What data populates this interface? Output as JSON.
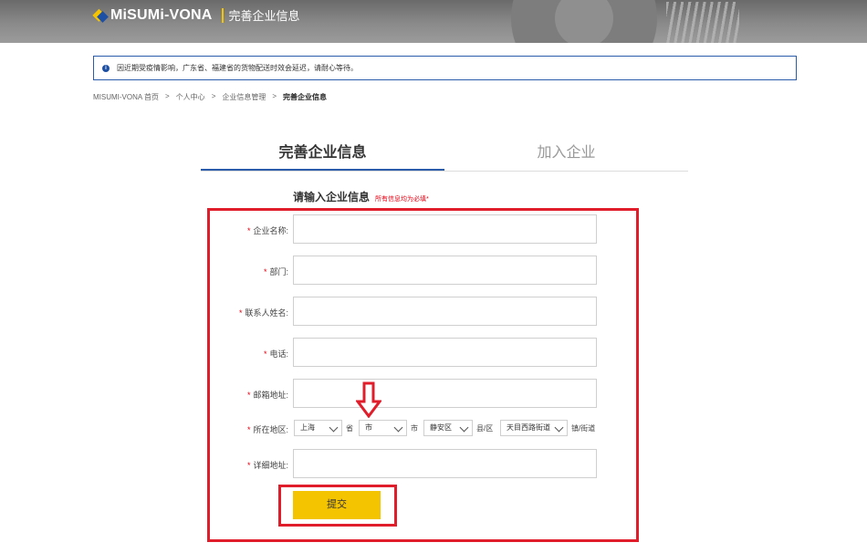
{
  "header": {
    "logo_text": "MiSUMi-VONA",
    "subtitle": "完善企业信息"
  },
  "notice": {
    "icon": "info-icon",
    "text": "因近期受疫情影响，广东省、福建省的货物配送时效会延迟，请耐心等待。"
  },
  "breadcrumb": {
    "items": [
      "MISUMI-VONA 首页",
      "个人中心",
      "企业信息管理",
      "完善企业信息"
    ],
    "separator": ">"
  },
  "tabs": [
    {
      "label": "完善企业信息",
      "active": true
    },
    {
      "label": "加入企业",
      "active": false
    }
  ],
  "form": {
    "heading": "请输入企业信息",
    "required_note": "所有信息均为必填*",
    "required_mark": "*",
    "fields": {
      "company_name": "企业名称:",
      "department": "部门:",
      "contact_name": "联系人姓名:",
      "phone": "电话:",
      "email": "邮箱地址:",
      "region": "所在地区:",
      "address": "详细地址:"
    },
    "region": {
      "province": "上海",
      "province_unit": "省",
      "city": "市",
      "city_unit": "市",
      "district": "静安区",
      "district_unit": "县/区",
      "street": "天目西路街道",
      "street_unit": "镇/街道"
    },
    "submit_label": "提交"
  },
  "colors": {
    "accent_blue": "#2b5cab",
    "brand_yellow": "#f5c400",
    "highlight_red": "#e01e2b",
    "required_red": "#e60012"
  }
}
